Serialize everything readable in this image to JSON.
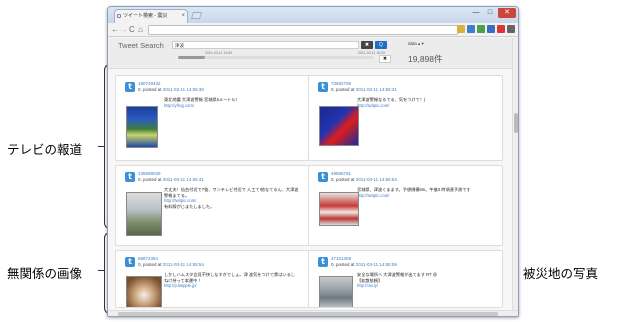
{
  "annotations": {
    "tv_report": "テレビの報道",
    "unrelated_image": "無関係の画像",
    "disaster_photo": "被災地の写真"
  },
  "browser": {
    "tab_title": "ツイート検索 - 震災",
    "tab_close": "×",
    "win_min": "—",
    "win_max": "□",
    "win_close": "✕",
    "nav_back": "←",
    "nav_forward": "→",
    "nav_reload": "C",
    "nav_home": "⌂"
  },
  "app": {
    "brand": "Tweet Search",
    "search_value": "津波",
    "search_button": "✖",
    "go_button": "Q",
    "user_menu": "data ▴ ▾",
    "date_start": "2011-03-11 14:50",
    "date_end": "2011-03-11 16:00",
    "clear_button": "✖",
    "result_count": "19,898件"
  },
  "colors": {
    "link_blue": "#3b7dc8",
    "avatar_blue": "#3b8fd6",
    "search_button_blue": "#1e6fc5"
  },
  "cards": [
    {
      "id": "180749432",
      "meta_prefix": "0, posted at",
      "timestamp": "2011-03-11 14:55:30",
      "text": "東北地震 大津波警報 宮城県6メートル！",
      "link": "http://yfrog.com/",
      "image_icon": "tv-broadcast-image"
    },
    {
      "id": "73592706",
      "meta_prefix": "0, posted at",
      "timestamp": "2011-03-11 14:55:31",
      "text": "大津波警報なるてる、気をつけて！(",
      "link": "http://twitpic.com/",
      "image_icon": "tv-broadcast-image"
    },
    {
      "id": "135688039",
      "meta_prefix": "0, posted at",
      "timestamp": "2011-03-11 14:55:41",
      "text": "大丈夫！仙台付近で7強、ワンテレビ付近で 人工て!他なてるん、大津波警報まてる。",
      "link": "http://twitpic.com/",
      "extra": "有料線がじまたしました。",
      "image_icon": "tv-broadcast-image"
    },
    {
      "id": "49556791",
      "meta_prefix": "0, posted at",
      "timestamp": "2011-03-11 14:55:54",
      "text": "宮城県、津波くまます。予想規模8m。午後3 時頃達予測です",
      "link": "http://twitpic.com/",
      "image_icon": "tv-broadcast-image"
    },
    {
      "id": "69872354",
      "meta_prefix": "0, posted at",
      "timestamp": "2011-03-11 14:55:54",
      "text": "しかしハムスタ会見不快しなすぎでしょ。津 波気をつけて雰はいるしねけ持って本運中 ！",
      "link": "http://p.twipple.jp/",
      "image_icon": "unrelated-image"
    },
    {
      "id": "47101308",
      "meta_prefix": "0, posted at",
      "timestamp": "2011-03-11 14:55:59",
      "text": "安全な場所へ 大津波警報が出てます RT @",
      "extra": "【拡散依頼】",
      "link": "http://ow.ly/",
      "image_icon": "disaster-photo"
    }
  ],
  "result_progress": 0.14
}
